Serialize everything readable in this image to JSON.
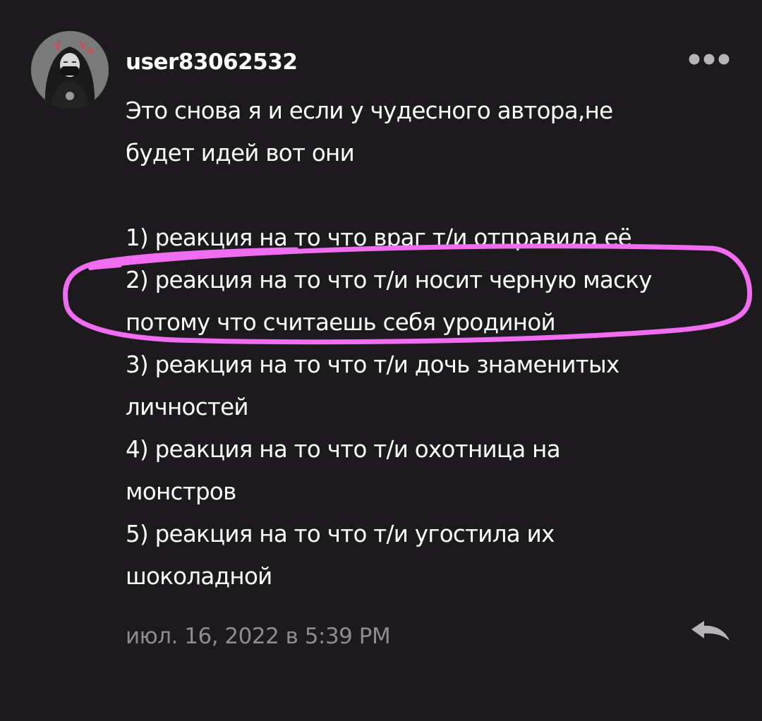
{
  "comment": {
    "username": "user83062532",
    "text_lines": [
      "Это снова я и если у чудесного автора,не",
      "будет идей вот они",
      "",
      "1) реакция на то что враг т/и отправила её",
      "2) реакция на то что т/и носит черную маску",
      "потому что считаешь себя уродиной",
      "3) реакция на то что т/и дочь знаменитых",
      "личностей",
      "4) реакция на то что т/и охотница на",
      "монстров",
      "5) реакция на то что т/и угостила их",
      "шоколадной"
    ],
    "timestamp": "июл. 16, 2022 в 5:39 PM"
  },
  "icons": {
    "more": "more-horizontal-icon",
    "reply": "reply-arrow-icon"
  },
  "colors": {
    "background": "#1c1a1d",
    "text": "#ffffff",
    "muted_text": "#8f8c91",
    "icon": "#b5b3b6",
    "highlight_marker": "#f06cf0"
  }
}
